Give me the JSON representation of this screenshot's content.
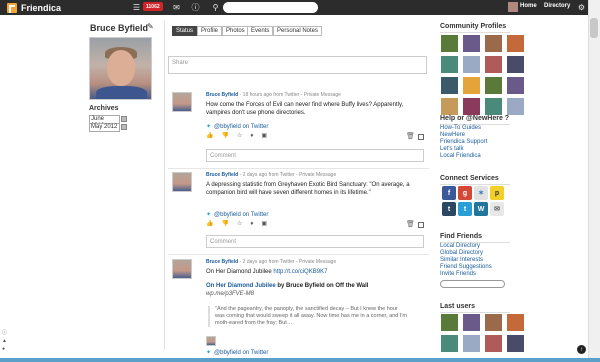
{
  "topbar": {
    "app_name": "Friendica",
    "notification_count": "11062",
    "search_placeholder": "",
    "nav": {
      "home": "Home",
      "directory": "Directory"
    }
  },
  "profile": {
    "name": "Bruce Byfield",
    "archives_title": "Archives",
    "archives": [
      "June 2012",
      "May 2012"
    ]
  },
  "tabs": [
    "Status",
    "Profile",
    "Photos",
    "Events",
    "Personal Notes"
  ],
  "share_placeholder": "Share",
  "posts": [
    {
      "author": "Bruce Byfield",
      "meta": " - 18 hours ago from Twitter - Private Message",
      "body": "How come the Forces of Evil can never find where Buffy lives? Apparently, vampires don't use phone directories.",
      "twitter": "@bbyfield on Twitter",
      "comment_placeholder": "Comment"
    },
    {
      "author": "Bruce Byfield",
      "meta": " - 2 days ago from Twitter - Private Message",
      "body": "A depressing statistic from Greyhaven Exotic Bird Sanctuary: \"On average, a companion bird will have seven different homes in its lifetime.\"",
      "twitter": "@bbyfield on Twitter",
      "comment_placeholder": "Comment"
    },
    {
      "author": "Bruce Byfield",
      "meta": " - 2 days ago from Twitter - Private Message",
      "body_text": "On Her Diamond Jubilee ",
      "body_link": "http://t.co/ciQKB9K7",
      "shared_link": "On Her Diamond Jubilee",
      "shared_by": " by Bruce Byfield on Off the Wall",
      "shared_sub": "wp.me/p3FVE-M8",
      "quote": "\"And the pageantry, the panoply, the sanctified decay – But I knew the hour was coming that would sweep it all away. Now time has me in a corner, and I'm moth-eared from the fray; But…",
      "twitter": "@bbyfield on Twitter"
    }
  ],
  "sidebar": {
    "community_title": "Community Profiles",
    "help_title": "Help or @NewHere ?",
    "help_links": [
      "How-To Guides",
      "NewHere",
      "Friendica Support",
      "Let's talk",
      "Local Friendica"
    ],
    "connect_title": "Connect Services",
    "find_title": "Find Friends",
    "find_links": [
      "Local Directory",
      "Global Directory",
      "Similar Interests",
      "Friend Suggestions",
      "Invite Friends"
    ],
    "last_users_title": "Last users"
  },
  "colors": {
    "topbar": "#2c2c2c",
    "accent_link": "#1a5c9c",
    "badge": "#d1232a",
    "logo": "#f3a537"
  }
}
